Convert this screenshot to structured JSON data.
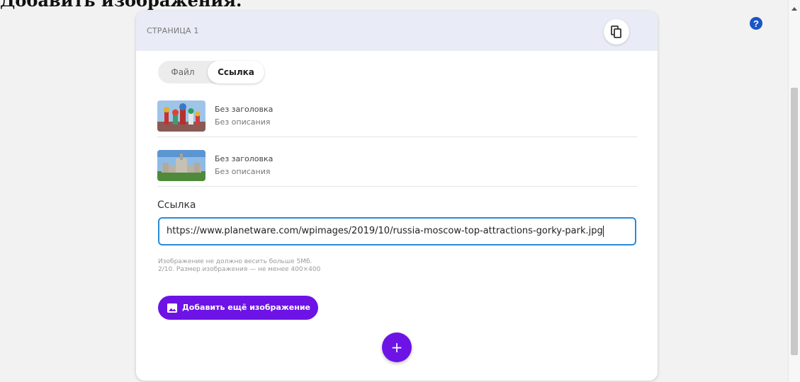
{
  "heading": "Добавить изображения.",
  "card": {
    "page_label": "СТРАНИЦА 1",
    "tabs": [
      {
        "label": "Файл",
        "active": false
      },
      {
        "label": "Ссылка",
        "active": true
      }
    ],
    "images": [
      {
        "title": "Без заголовка",
        "description": "Без описания"
      },
      {
        "title": "Без заголовка",
        "description": "Без описания"
      }
    ],
    "link_label": "Ссылка",
    "link_value": "https://www.planetware.com/wpimages/2019/10/russia-moscow-top-attractions-gorky-park.jpg",
    "hints": [
      "Изображение не должно весить больше 5Мб.",
      "2/10. Размер изображения — не менее 400×400"
    ],
    "add_image_label": "Добавить ещё изображение",
    "add_button_label": "+"
  },
  "help_label": "?",
  "colors": {
    "accent": "#6d13e6",
    "header_bg": "#e9ecf6",
    "input_border": "#2a8bd6",
    "help_icon": "#1a56c4"
  },
  "icons": {
    "copy": "copy-icon",
    "image": "image-icon",
    "help": "help-icon",
    "plus": "plus-icon"
  }
}
